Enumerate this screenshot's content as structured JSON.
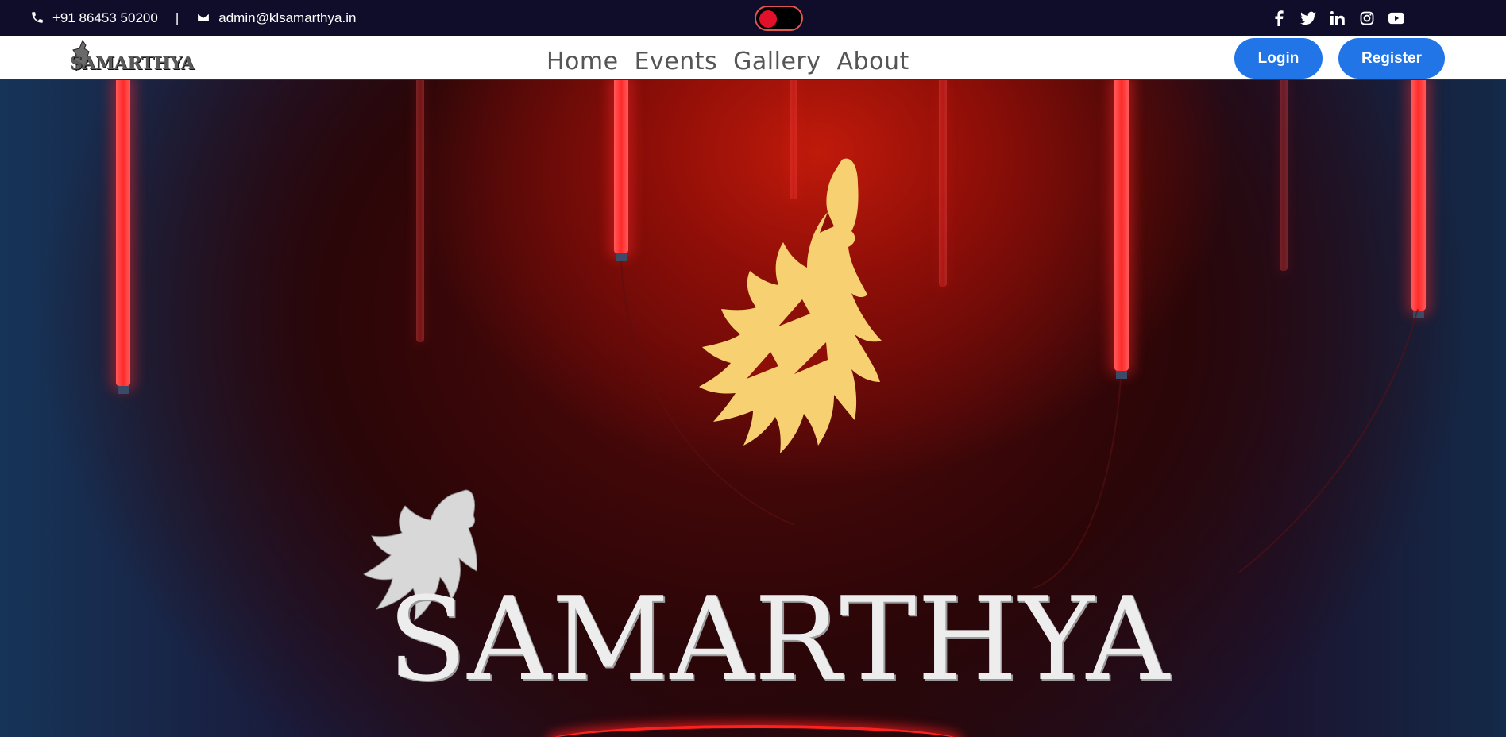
{
  "topbar": {
    "phone": "+91 86453 50200",
    "separator": "|",
    "email": "admin@klsamarthya.in",
    "icons": [
      "phone-icon",
      "envelope-icon"
    ],
    "socials": [
      "facebook-icon",
      "twitter-icon",
      "linkedin-icon",
      "instagram-icon",
      "youtube-icon"
    ],
    "background": "#0f0d2a"
  },
  "theme_toggle": {
    "knob_color": "#e3102a",
    "border_color": "#e0554e"
  },
  "nav": {
    "logo_text": "SAMARTHYA",
    "items": [
      {
        "label": "Home"
      },
      {
        "label": "Events"
      },
      {
        "label": "Gallery"
      },
      {
        "label": "About"
      }
    ],
    "login_label": "Login",
    "register_label": "Register",
    "button_color": "#2175e6"
  },
  "hero": {
    "brand_text": "SAMARTHYA",
    "accent": "#c01a0a",
    "wolf_color": "#f7d171"
  }
}
